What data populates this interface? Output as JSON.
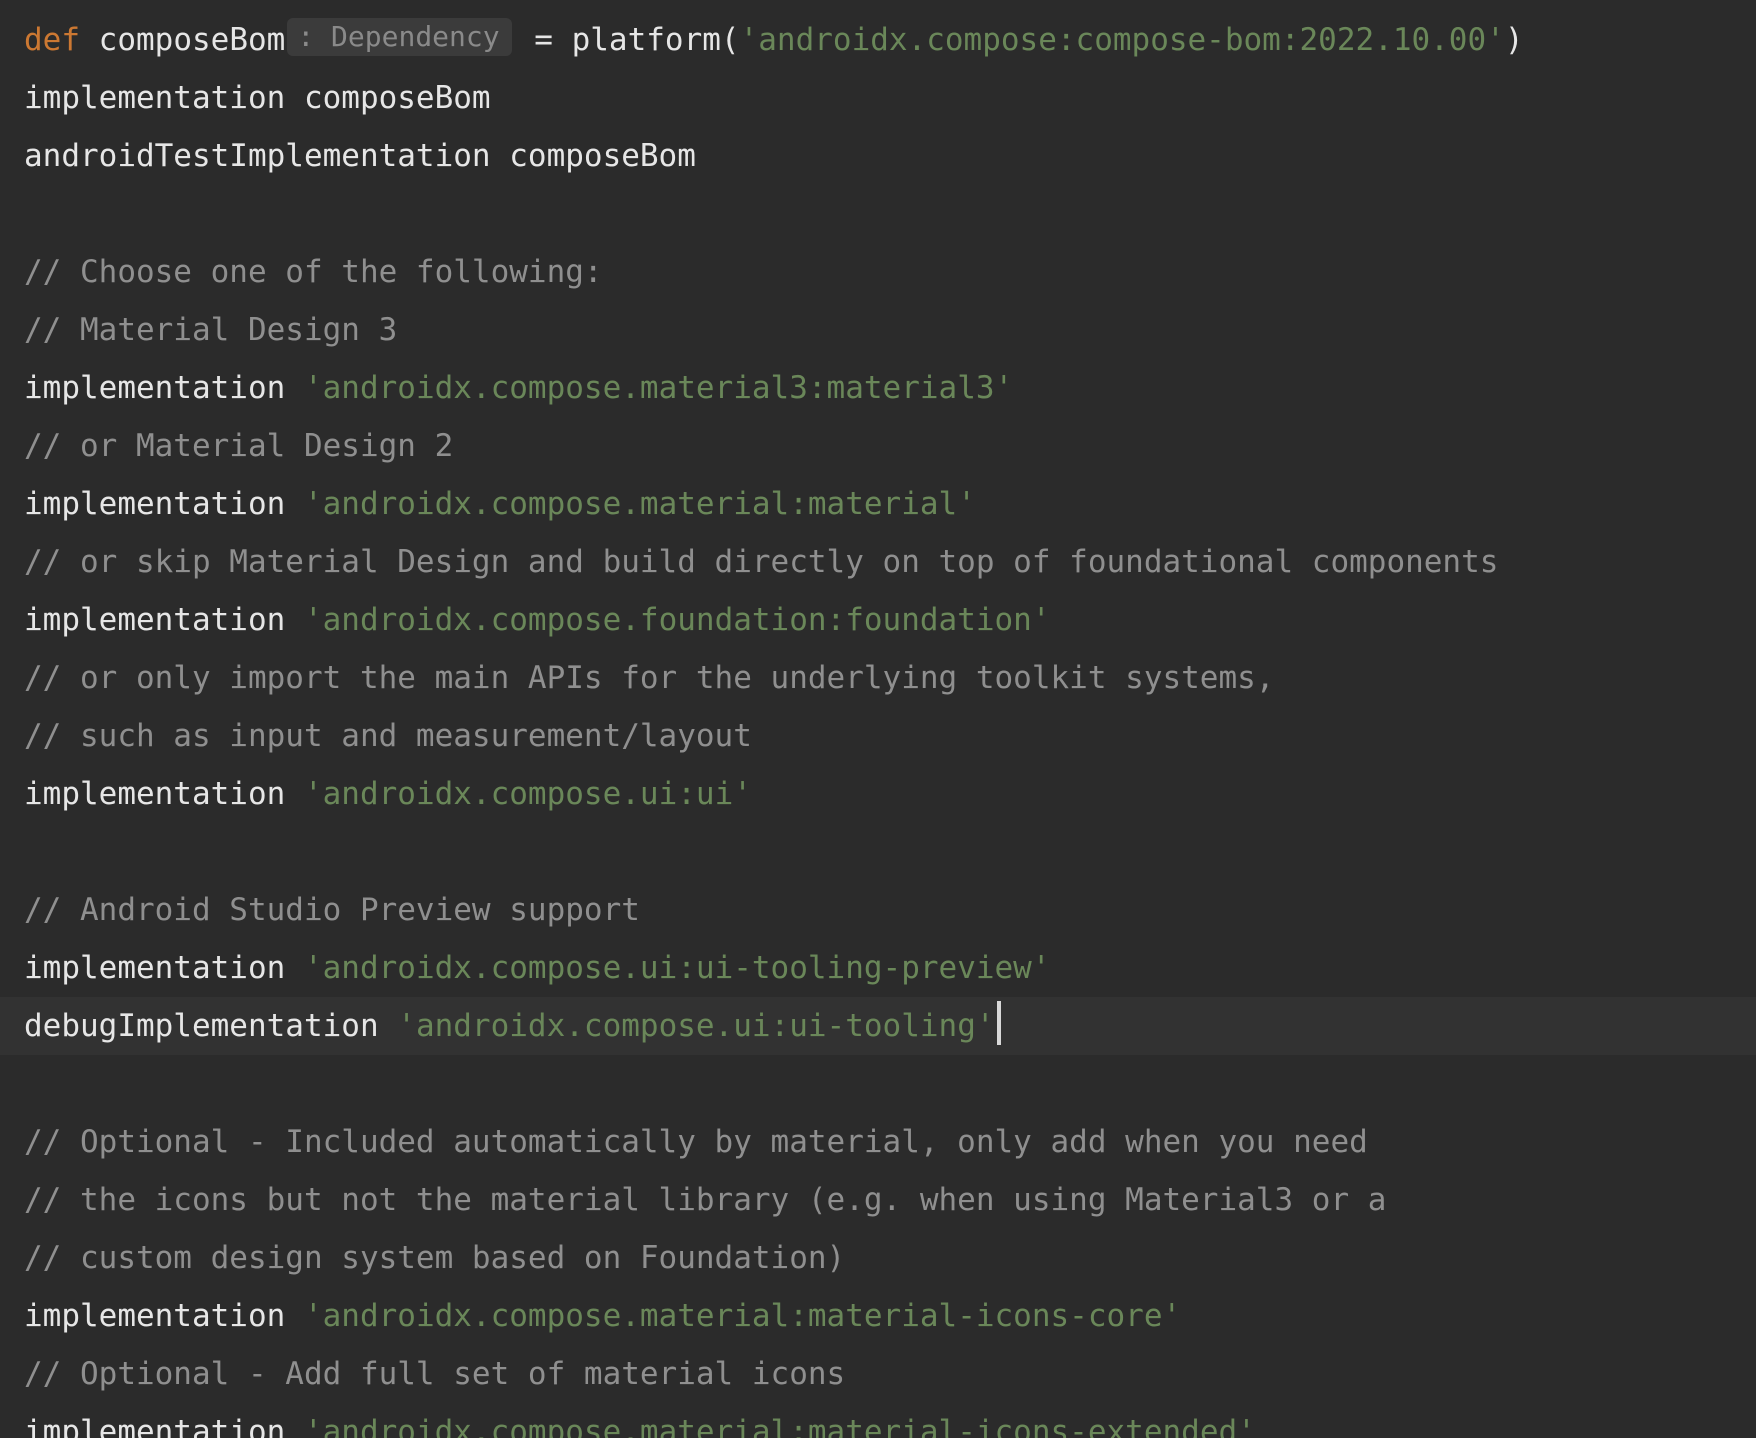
{
  "editor": {
    "lines": [
      {
        "decl_keyword": "def",
        "name": "composeBom",
        "type_hint": ": Dependency",
        "op": "= platform(",
        "string": "'androidx.compose:compose-bom:2022.10.00'",
        "close": ")"
      },
      {
        "text": "implementation composeBom"
      },
      {
        "text": "androidTestImplementation composeBom"
      },
      {},
      {
        "comment": "// Choose one of the following:"
      },
      {
        "comment": "// Material Design 3"
      },
      {
        "keyword": "implementation",
        "string": "'androidx.compose.material3:material3'"
      },
      {
        "comment": "// or Material Design 2"
      },
      {
        "keyword": "implementation",
        "string": "'androidx.compose.material:material'"
      },
      {
        "comment": "// or skip Material Design and build directly on top of foundational components"
      },
      {
        "keyword": "implementation",
        "string": "'androidx.compose.foundation:foundation'"
      },
      {
        "comment": "// or only import the main APIs for the underlying toolkit systems,"
      },
      {
        "comment": "// such as input and measurement/layout"
      },
      {
        "keyword": "implementation",
        "string": "'androidx.compose.ui:ui'"
      },
      {},
      {
        "comment": "// Android Studio Preview support"
      },
      {
        "keyword": "implementation",
        "string": "'androidx.compose.ui:ui-tooling-preview'"
      },
      {
        "keyword": "debugImplementation",
        "string": "'androidx.compose.ui:ui-tooling'",
        "current": true
      },
      {},
      {
        "comment": "// Optional - Included automatically by material, only add when you need"
      },
      {
        "comment": "// the icons but not the material library (e.g. when using Material3 or a"
      },
      {
        "comment": "// custom design system based on Foundation)"
      },
      {
        "keyword": "implementation",
        "string": "'androidx.compose.material:material-icons-core'"
      },
      {
        "comment": "// Optional - Add full set of material icons"
      },
      {
        "keyword": "implementation",
        "string": "'androidx.compose.material:material-icons-extended'"
      }
    ]
  },
  "colors": {
    "background": "#2b2b2b",
    "current_line": "#323232",
    "keyword": "#cc7832",
    "text": "#e6e6e6",
    "string": "#6a8759",
    "comment": "#8f8f8f"
  }
}
